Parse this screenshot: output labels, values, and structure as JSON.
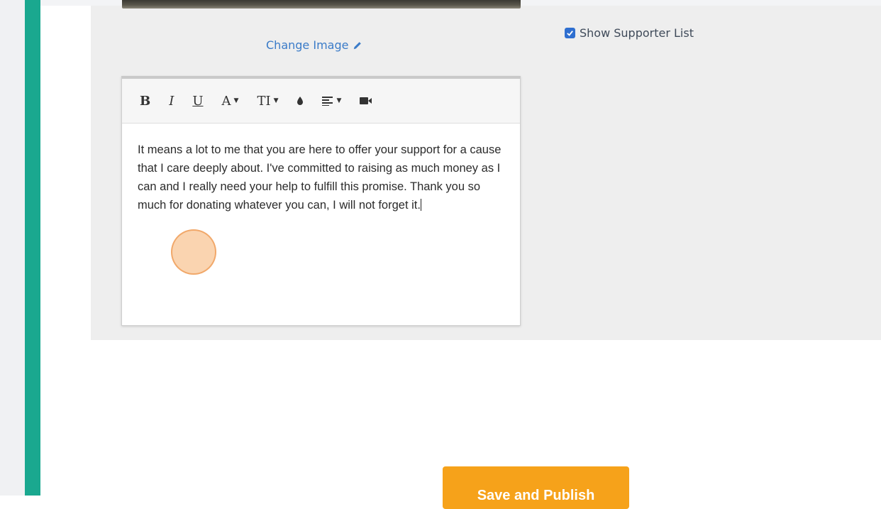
{
  "editor": {
    "change_image_label": "Change Image",
    "show_supporter_list_label": "Show Supporter List",
    "show_supporter_list_checked": true,
    "toolbar": {
      "bold": "B",
      "italic": "I",
      "underline": "U",
      "font_color": "A",
      "font_size": "TI",
      "icons": [
        "bold-icon",
        "italic-icon",
        "underline-icon",
        "font-color-icon",
        "font-size-icon",
        "drop-icon",
        "align-icon",
        "video-icon"
      ]
    },
    "body_text": "It means a lot to me that you are here to offer your support for a cause that I care deeply about. I've committed to raising as much money as I can and I really need your help to fulfill this promise. Thank you so much for donating whatever you can, I will not forget it."
  },
  "footer": {
    "publish_label": "Save and Publish"
  },
  "colors": {
    "accent": "#1aa88f",
    "link": "#3a7bc8",
    "button": "#f6a21a",
    "checkbox": "#2f6fd0"
  }
}
